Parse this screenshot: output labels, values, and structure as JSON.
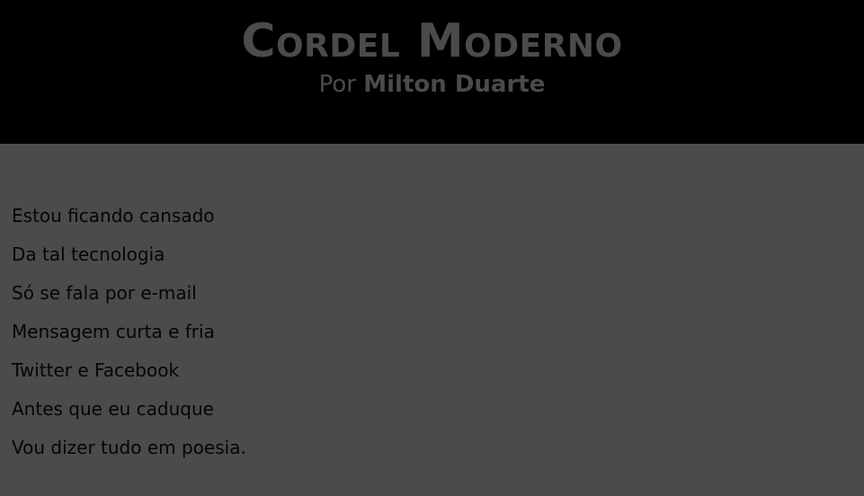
{
  "header": {
    "title": "Cordel Moderno",
    "byline_prefix": "Por ",
    "author": "Milton Duarte",
    "background": "#000000",
    "text_color": "#4b4b4b"
  },
  "poem": {
    "lines": [
      "Estou ficando cansado",
      "Da tal tecnologia",
      "Só se fala por e-mail",
      "Mensagem curta e fria",
      "Twitter e Facebook",
      "Antes que eu caduque",
      "Vou dizer tudo em poesia."
    ],
    "background": "#4b4b4b",
    "text_color": "#050505"
  }
}
